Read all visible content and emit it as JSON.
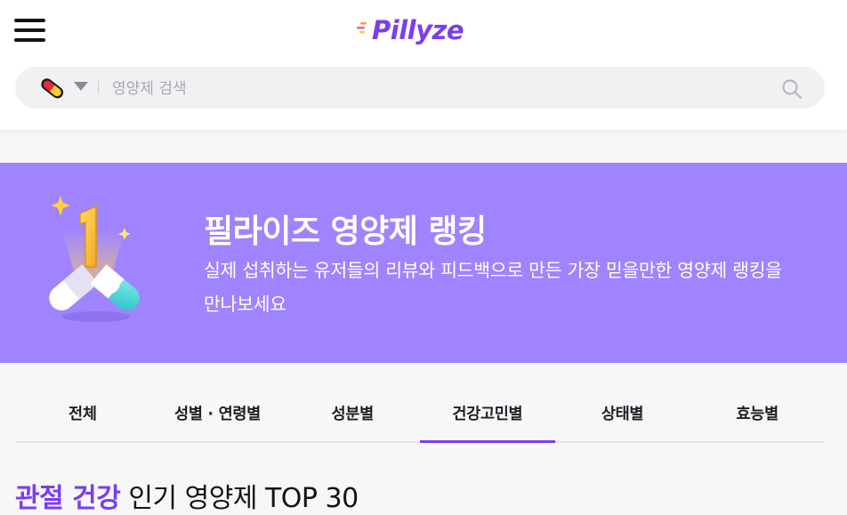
{
  "header": {
    "logo_text": "Pillyze",
    "brand_color": "#7b3df0",
    "menu_icon": "hamburger-menu-icon"
  },
  "search": {
    "placeholder": "영양제 검색",
    "category_icon": "pill-capsule-icon",
    "dropdown_icon": "caret-down-icon",
    "search_icon": "magnifier-icon"
  },
  "banner": {
    "title": "필라이즈 영양제 랭킹",
    "description": "실제 섭취하는 유저들의 리뷰와 피드백으로 만든 가장 믿을만한 영양제 랭킹을 만나보세요",
    "background_color": "#a083fe",
    "illustration": "rank-one-trophy-capsules-icon"
  },
  "tabs": [
    {
      "label": "전체",
      "active": false
    },
    {
      "label": "성별 · 연령별",
      "active": false
    },
    {
      "label": "성분별",
      "active": false
    },
    {
      "label": "건강고민별",
      "active": true
    },
    {
      "label": "상태별",
      "active": false
    },
    {
      "label": "효능별",
      "active": false
    }
  ],
  "section": {
    "highlight": "관절 건강",
    "rest": "인기 영양제 TOP 30"
  }
}
